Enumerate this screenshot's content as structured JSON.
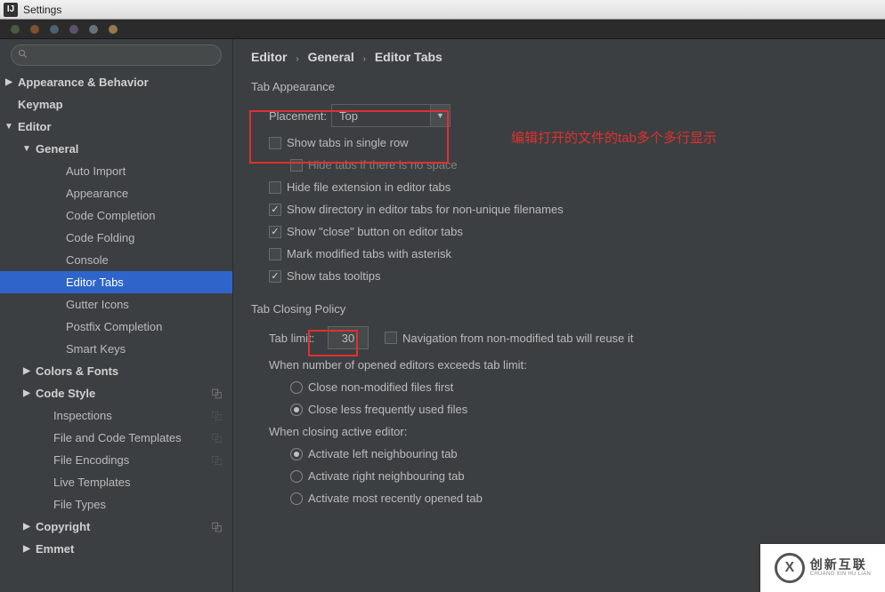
{
  "window": {
    "title": "Settings"
  },
  "sidebar": {
    "search_placeholder": "",
    "items": [
      {
        "label": "Appearance & Behavior"
      },
      {
        "label": "Keymap"
      },
      {
        "label": "Editor"
      },
      {
        "label": "General"
      },
      {
        "label": "Auto Import"
      },
      {
        "label": "Appearance"
      },
      {
        "label": "Code Completion"
      },
      {
        "label": "Code Folding"
      },
      {
        "label": "Console"
      },
      {
        "label": "Editor Tabs"
      },
      {
        "label": "Gutter Icons"
      },
      {
        "label": "Postfix Completion"
      },
      {
        "label": "Smart Keys"
      },
      {
        "label": "Colors & Fonts"
      },
      {
        "label": "Code Style"
      },
      {
        "label": "Inspections"
      },
      {
        "label": "File and Code Templates"
      },
      {
        "label": "File Encodings"
      },
      {
        "label": "Live Templates"
      },
      {
        "label": "File Types"
      },
      {
        "label": "Copyright"
      },
      {
        "label": "Emmet"
      }
    ]
  },
  "breadcrumb": {
    "a": "Editor",
    "b": "General",
    "c": "Editor Tabs"
  },
  "sections": {
    "tab_appearance": "Tab Appearance",
    "tab_closing": "Tab Closing Policy"
  },
  "placement": {
    "label": "Placement:",
    "value": "Top"
  },
  "checks": {
    "single_row": "Show tabs in single row",
    "hide_no_space": "Hide tabs if there is no space",
    "hide_ext": "Hide file extension in editor tabs",
    "show_dir": "Show directory in editor tabs for non-unique filenames",
    "show_close": "Show \"close\" button on editor tabs",
    "mark_asterisk": "Mark modified tabs with asterisk",
    "tooltips": "Show tabs tooltips"
  },
  "closing": {
    "tab_limit_label": "Tab limit:",
    "tab_limit_value": "30",
    "reuse": "Navigation from non-modified tab will reuse it",
    "exceeds": "When number of opened editors exceeds tab limit:",
    "close_nonmod": "Close non-modified files first",
    "close_lfu": "Close less frequently used files",
    "when_closing": "When closing active editor:",
    "act_left": "Activate left neighbouring tab",
    "act_right": "Activate right neighbouring tab",
    "act_recent": "Activate most recently opened tab"
  },
  "annotation": "编辑打开的文件的tab多个多行显示",
  "logo": {
    "cn": "创新互联",
    "en": "CHUANG XIN HU LIAN"
  }
}
